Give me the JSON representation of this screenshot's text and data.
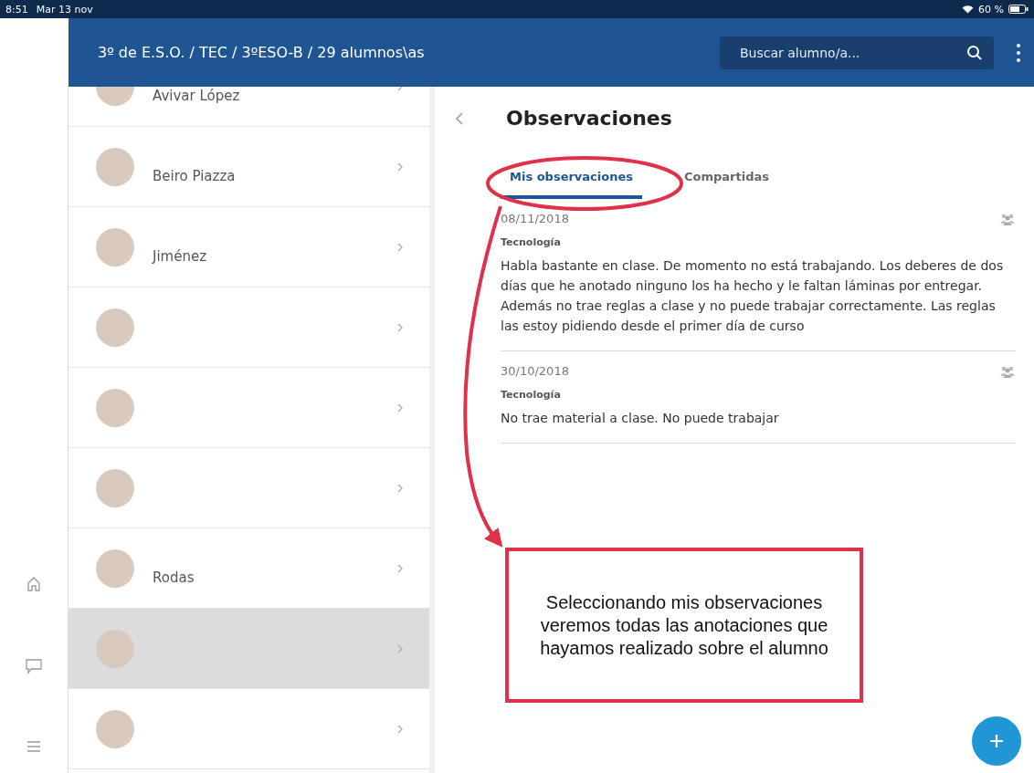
{
  "status_bar": {
    "time": "8:51",
    "date": "Mar 13 nov",
    "battery": "60 %"
  },
  "header": {
    "breadcrumb": "3º de E.S.O. / TEC / 3ºESO-B / 29 alumnos\\as",
    "search": {
      "placeholder": "Buscar alumno/a..."
    }
  },
  "students": [
    {
      "name": "Avivar López",
      "selected": false
    },
    {
      "name": "Beiro Piazza",
      "selected": false
    },
    {
      "name": "Jiménez",
      "selected": false
    },
    {
      "selected": false
    },
    {
      "selected": false
    },
    {
      "selected": false
    },
    {
      "name": "Rodas",
      "selected": false
    },
    {
      "selected": true
    },
    {
      "selected": false
    }
  ],
  "panel": {
    "title": "Observaciones",
    "tabs": [
      {
        "label": "Mis observaciones",
        "selected": true
      },
      {
        "label": "Compartidas",
        "selected": false
      }
    ],
    "observations": [
      {
        "date": "08/11/2018",
        "subject": "Tecnología",
        "text": "Habla bastante en clase. De momento no está trabajando. Los deberes de dos días que he anotado ninguno los ha hecho y le faltan láminas por entregar. Además no trae reglas a clase y no puede trabajar correctamente. Las reglas las estoy pidiendo desde el primer día de curso"
      },
      {
        "date": "30/10/2018",
        "subject": "Tecnología",
        "text": "No trae material a clase. No puede trabajar"
      }
    ]
  },
  "annotation": {
    "text": "Seleccionando mis observaciones veremos todas las anotaciones que hayamos realizado sobre el alumno"
  }
}
